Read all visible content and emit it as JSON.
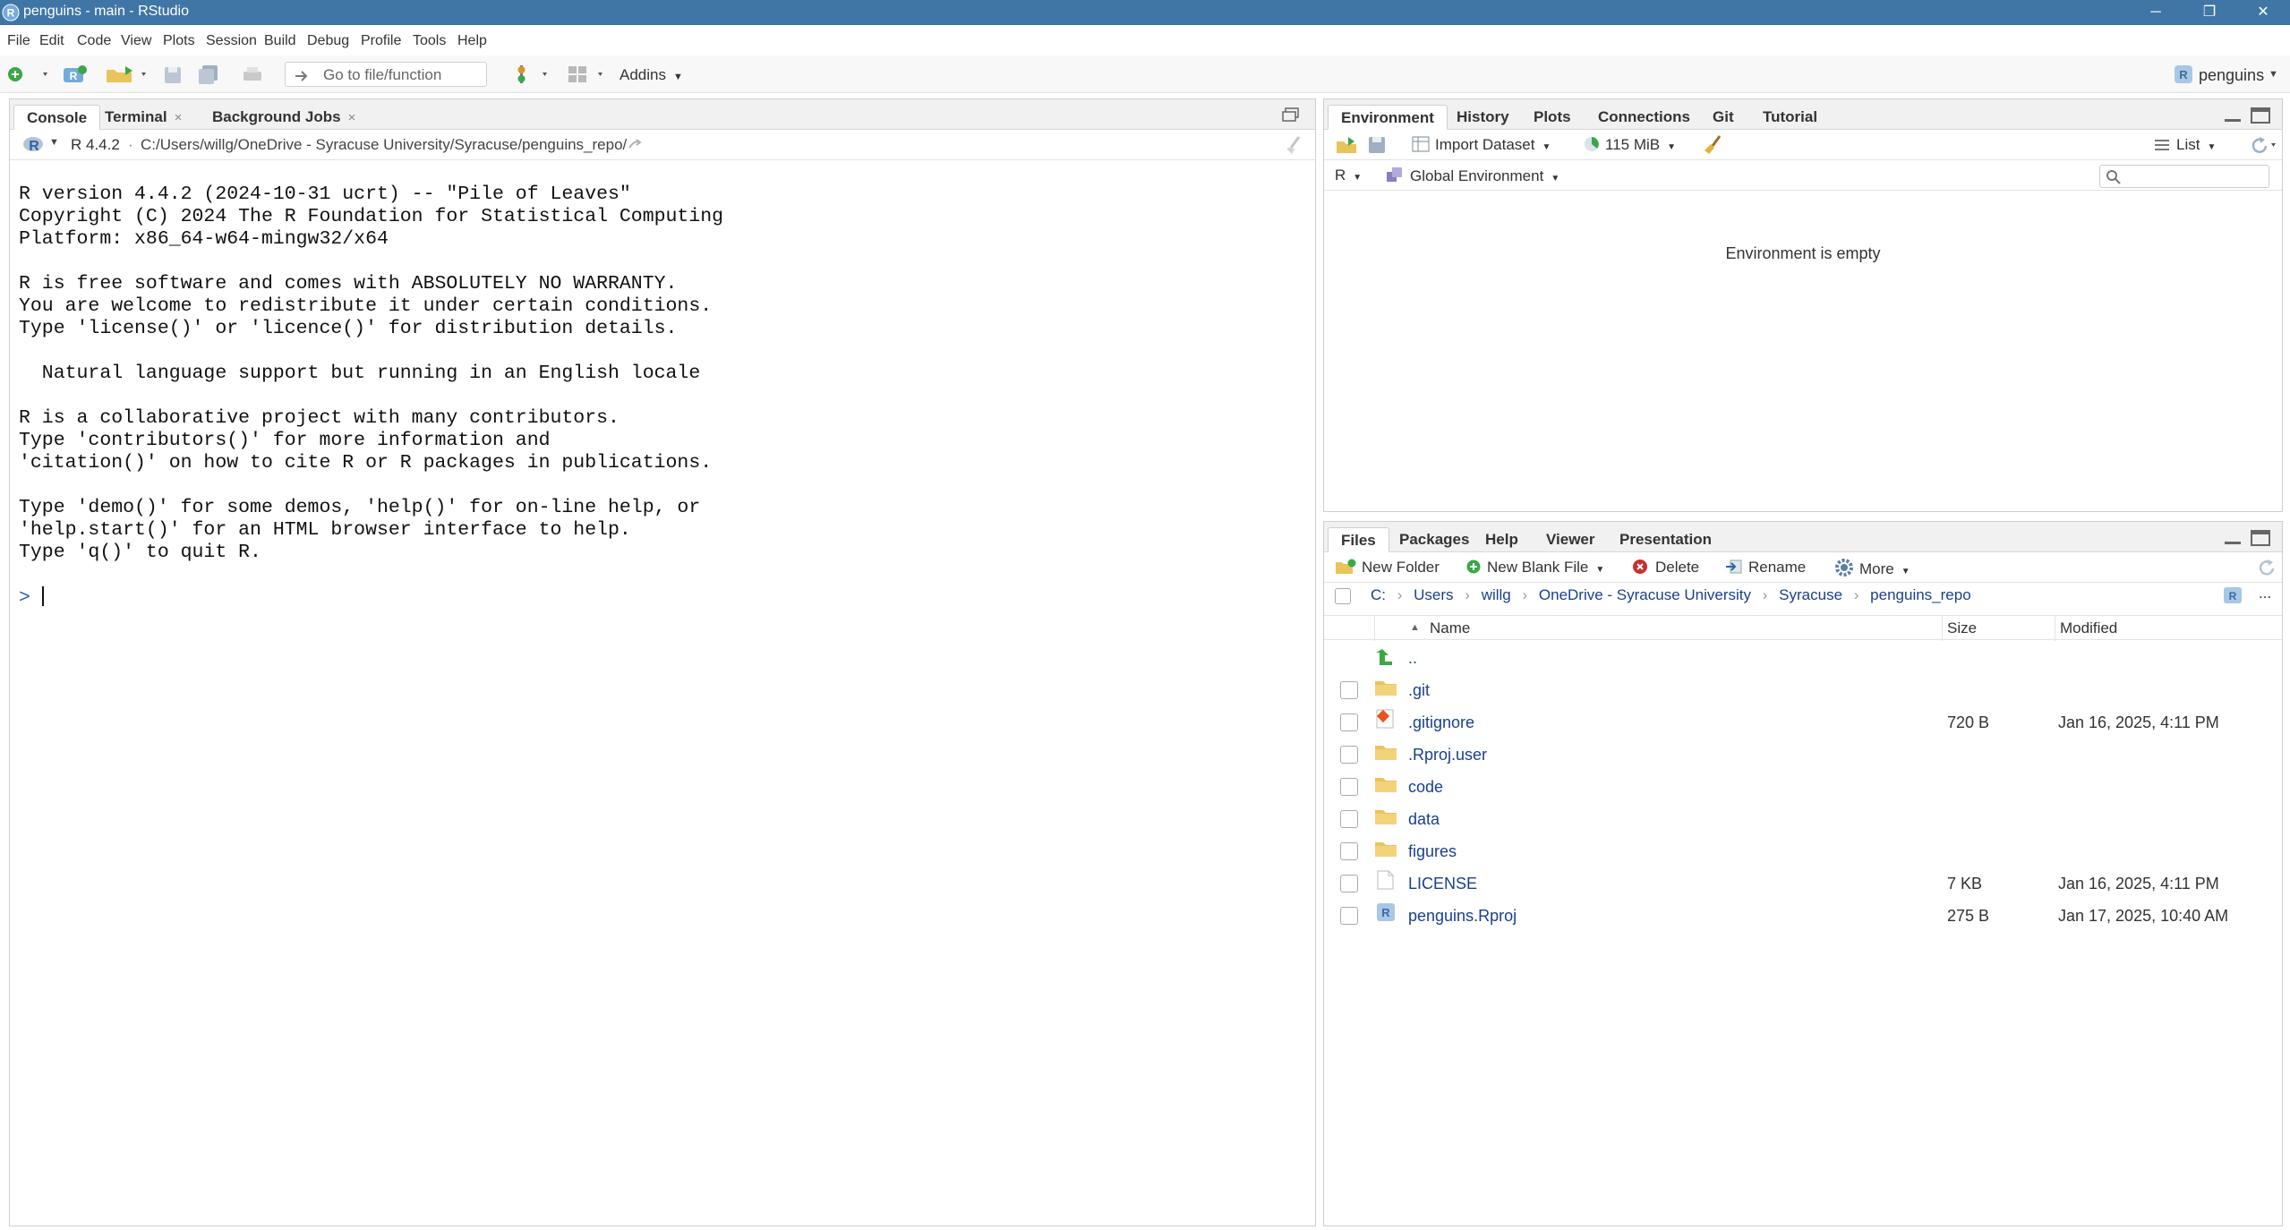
{
  "window": {
    "title": "penguins - main - RStudio",
    "minimize": "─",
    "maximize": "❐",
    "close": "✕"
  },
  "menu": [
    "File",
    "Edit",
    "Code",
    "View",
    "Plots",
    "Session",
    "Build",
    "Debug",
    "Profile",
    "Tools",
    "Help"
  ],
  "toolbar": {
    "goto_placeholder": "Go to file/function",
    "addins_label": "Addins",
    "project_label": "penguins"
  },
  "console_pane": {
    "tabs": [
      {
        "label": "Console"
      },
      {
        "label": "Terminal"
      },
      {
        "label": "Background Jobs"
      }
    ],
    "close_glyph": "×",
    "r_version_label": "R 4.4.2",
    "separator": "·",
    "path": "C:/Users/willg/OneDrive - Syracuse University/Syracuse/penguins_repo/",
    "output_lines": [
      "R version 4.4.2 (2024-10-31 ucrt) -- \"Pile of Leaves\"",
      "Copyright (C) 2024 The R Foundation for Statistical Computing",
      "Platform: x86_64-w64-mingw32/x64",
      "",
      "R is free software and comes with ABSOLUTELY NO WARRANTY.",
      "You are welcome to redistribute it under certain conditions.",
      "Type 'license()' or 'licence()' for distribution details.",
      "",
      "  Natural language support but running in an English locale",
      "",
      "R is a collaborative project with many contributors.",
      "Type 'contributors()' for more information and",
      "'citation()' on how to cite R or R packages in publications.",
      "",
      "Type 'demo()' for some demos, 'help()' for on-line help, or",
      "'help.start()' for an HTML browser interface to help.",
      "Type 'q()' to quit R."
    ],
    "prompt": ">"
  },
  "env_pane": {
    "tabs": [
      {
        "label": "Environment"
      },
      {
        "label": "History"
      },
      {
        "label": "Plots"
      },
      {
        "label": "Connections"
      },
      {
        "label": "Git"
      },
      {
        "label": "Tutorial"
      }
    ],
    "import_dataset_label": "Import Dataset",
    "memory_label": "115 MiB",
    "view_mode_label": "List",
    "language_label": "R",
    "environment_label": "Global Environment",
    "empty_message": "Environment is empty"
  },
  "files_pane": {
    "tabs": [
      {
        "label": "Files"
      },
      {
        "label": "Packages"
      },
      {
        "label": "Help"
      },
      {
        "label": "Viewer"
      },
      {
        "label": "Presentation"
      }
    ],
    "actions": {
      "new_folder": "New Folder",
      "new_blank_file": "New Blank File",
      "delete": "Delete",
      "rename": "Rename",
      "more": "More"
    },
    "breadcrumb": [
      "C:",
      "Users",
      "willg",
      "OneDrive - Syracuse University",
      "Syracuse",
      "penguins_repo"
    ],
    "breadcrumb_sep": "›",
    "more_glyph": "...",
    "columns": {
      "name": "Name",
      "size": "Size",
      "modified": "Modified"
    },
    "parent_dir_label": "..",
    "rows": [
      {
        "name": ".git",
        "type": "folder",
        "size": "",
        "modified": ""
      },
      {
        "name": ".gitignore",
        "type": "gitignore",
        "size": "720 B",
        "modified": "Jan 16, 2025, 4:11 PM"
      },
      {
        "name": ".Rproj.user",
        "type": "folder",
        "size": "",
        "modified": ""
      },
      {
        "name": "code",
        "type": "folder",
        "size": "",
        "modified": ""
      },
      {
        "name": "data",
        "type": "folder",
        "size": "",
        "modified": ""
      },
      {
        "name": "figures",
        "type": "folder",
        "size": "",
        "modified": ""
      },
      {
        "name": "LICENSE",
        "type": "file",
        "size": "7 KB",
        "modified": "Jan 16, 2025, 4:11 PM"
      },
      {
        "name": "penguins.Rproj",
        "type": "rproj",
        "size": "275 B",
        "modified": "Jan 17, 2025, 10:40 AM"
      }
    ]
  },
  "colors": {
    "titlebar": "#3f76a5",
    "link": "#1a3f8f",
    "folder": "#e9c45a",
    "accent_blue": "#4a88c7"
  }
}
